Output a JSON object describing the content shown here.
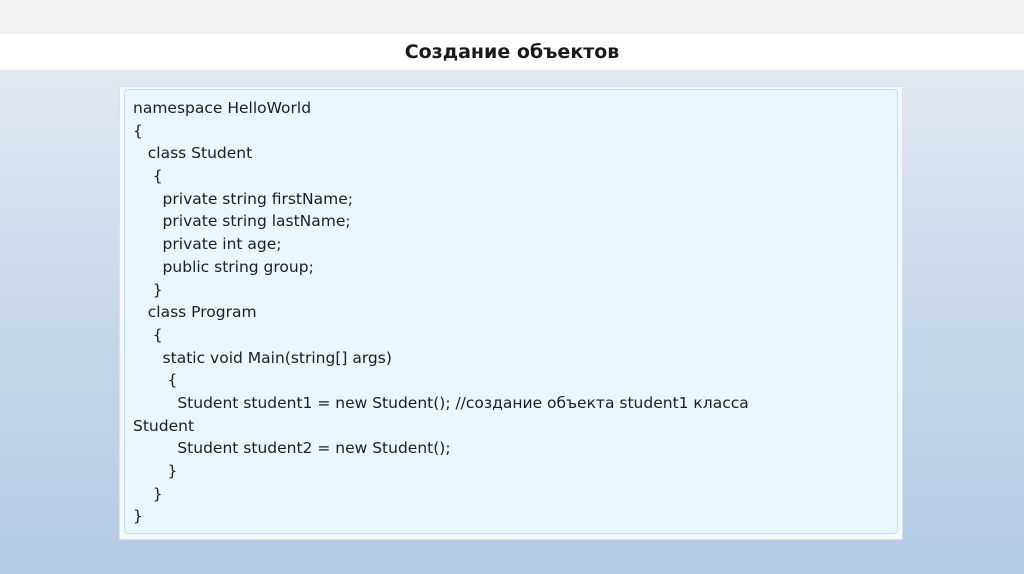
{
  "slide": {
    "title": "Создание объектов"
  },
  "code": {
    "lines": [
      "namespace HelloWorld",
      "{",
      "   class Student",
      "    {",
      "      private string firstName;",
      "      private string lastName;",
      "      private int age;",
      "      public string group;",
      "    }",
      "   class Program",
      "    {",
      "      static void Main(string[] args)",
      "       {",
      "         Student student1 = new Student(); //создание объекта student1 класса",
      "Student",
      "         Student student2 = new Student();",
      "       }",
      "    }",
      "}"
    ]
  }
}
